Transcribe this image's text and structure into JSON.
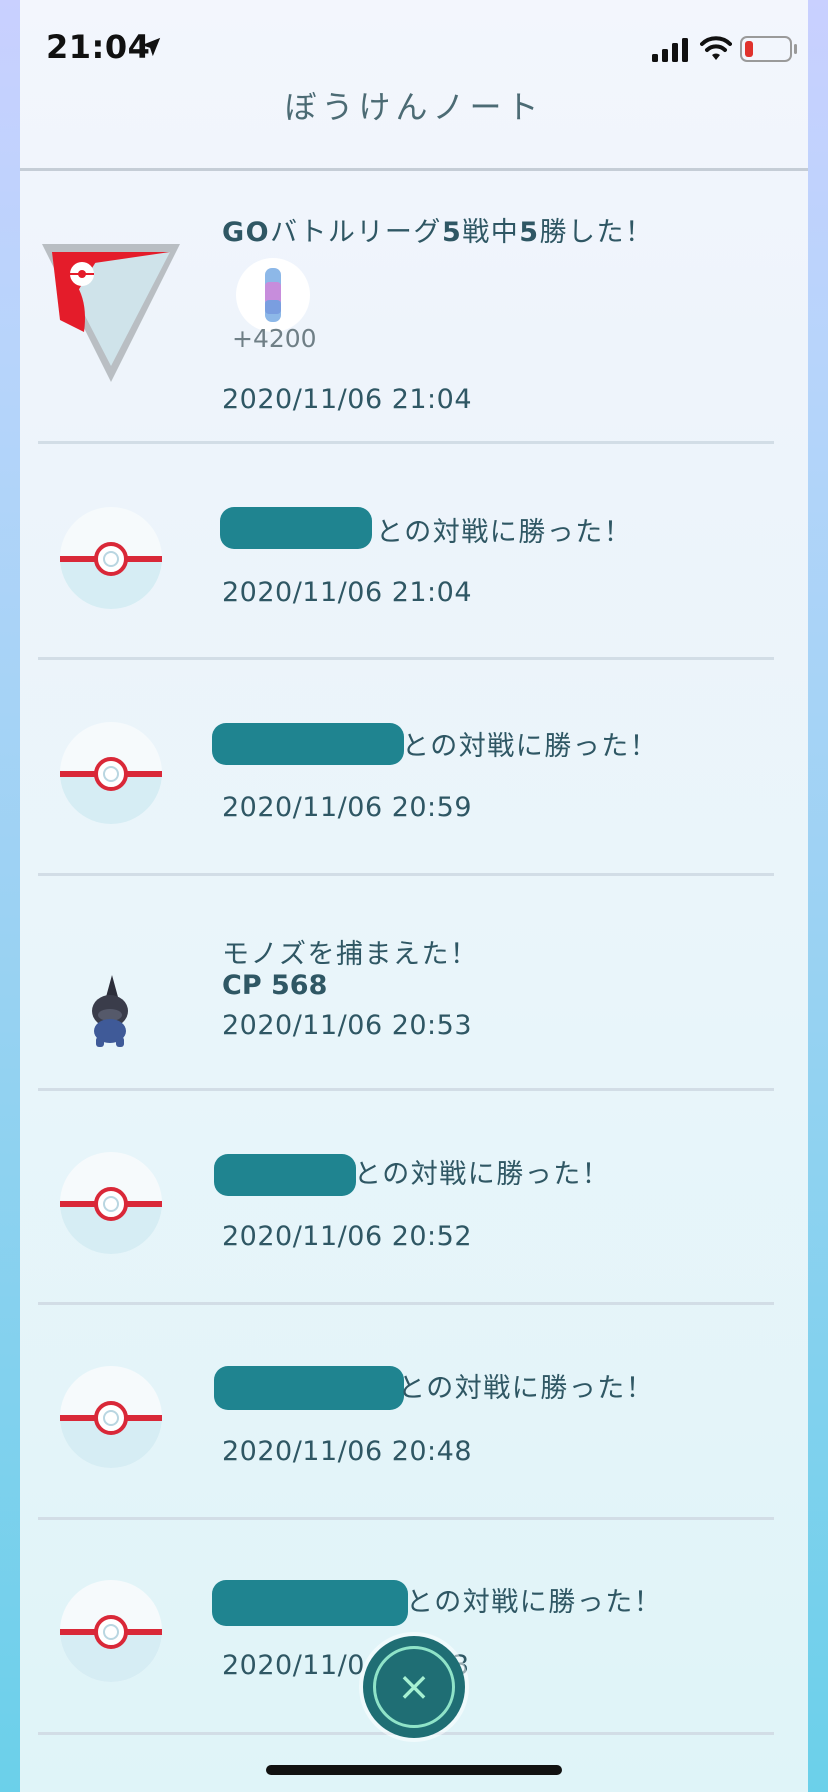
{
  "status_bar": {
    "time": "21:04",
    "icons": [
      "location-arrow-icon",
      "signal-icon",
      "wifi-icon",
      "battery-icon"
    ],
    "battery_color": "#e0322d"
  },
  "header": {
    "title": "ぼうけんノート"
  },
  "entries": [
    {
      "type": "battle-league",
      "icon": "battle-league-badge-icon",
      "title_parts": [
        "GO",
        "バトルリーグ",
        "5",
        "戦中",
        "5",
        "勝した！"
      ],
      "reward_icon": "stardust-icon",
      "reward_amount": "+4200",
      "date": "2020/11/06 21:04"
    },
    {
      "type": "battle-win",
      "icon": "premier-ball-icon",
      "text": "との対戦に勝った！",
      "date": "2020/11/06 21:04"
    },
    {
      "type": "battle-win",
      "icon": "premier-ball-icon",
      "text": "との対戦に勝った！",
      "date": "2020/11/06 20:59"
    },
    {
      "type": "catch",
      "icon": "deino-pokemon-icon",
      "text": "モノズを捕まえた！",
      "cp": "CP 568",
      "date": "2020/11/06 20:53"
    },
    {
      "type": "battle-win",
      "icon": "premier-ball-icon",
      "text": "との対戦に勝った！",
      "date": "2020/11/06 20:52"
    },
    {
      "type": "battle-win",
      "icon": "premier-ball-icon",
      "text": "との対戦に勝った！",
      "date": "2020/11/06 20:48"
    },
    {
      "type": "battle-win",
      "icon": "premier-ball-icon",
      "text": "との対戦に勝った！",
      "date_visible_start": "2020/11/0",
      "date_visible_end": "3"
    }
  ],
  "close_button": {
    "icon": "close-icon",
    "glyph": "×"
  },
  "colors": {
    "text": "#2f5764",
    "redaction": "#1f8490",
    "close_button": "#1f6e74"
  }
}
